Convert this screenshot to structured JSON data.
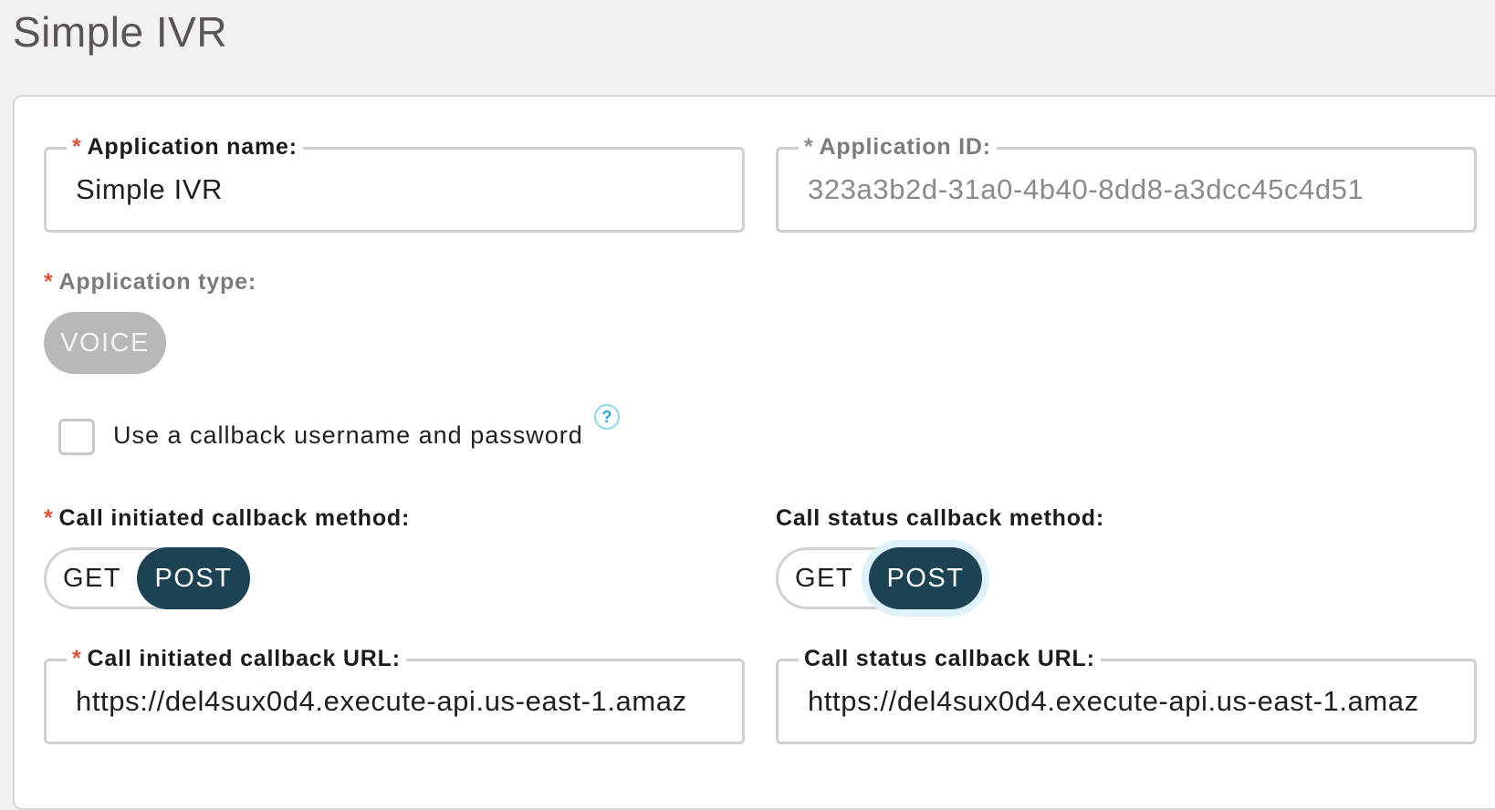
{
  "page": {
    "title": "Simple IVR"
  },
  "form": {
    "app_name": {
      "label": "Application name:",
      "required_mark": "*",
      "value": "Simple IVR"
    },
    "app_id": {
      "label": "Application ID:",
      "required_mark": "*",
      "value": "323a3b2d-31a0-4b40-8dd8-a3dcc45c4d51"
    },
    "app_type": {
      "label": "Application type:",
      "required_mark": "*",
      "value": "VOICE"
    },
    "callback_auth": {
      "label": "Use a callback username and password",
      "checked": false,
      "help_icon": "?"
    },
    "initiated_method": {
      "label": "Call initiated callback method:",
      "required_mark": "*",
      "options": [
        "GET",
        "POST"
      ],
      "selected": "POST"
    },
    "status_method": {
      "label": "Call status callback method:",
      "options": [
        "GET",
        "POST"
      ],
      "selected": "POST"
    },
    "initiated_url": {
      "label": "Call initiated callback URL:",
      "required_mark": "*",
      "value": "https://del4sux0d4.execute-api.us-east-1.amaz"
    },
    "status_url": {
      "label": "Call status callback URL:",
      "value": "https://del4sux0d4.execute-api.us-east-1.amaz"
    }
  },
  "colors": {
    "required": "#d9543b",
    "toggle_selected": "#1c4254",
    "help_icon": "#2aa6d6",
    "disabled_pill": "#b9b8b8"
  },
  "icons": {
    "help": "question-mark-circle-icon"
  }
}
